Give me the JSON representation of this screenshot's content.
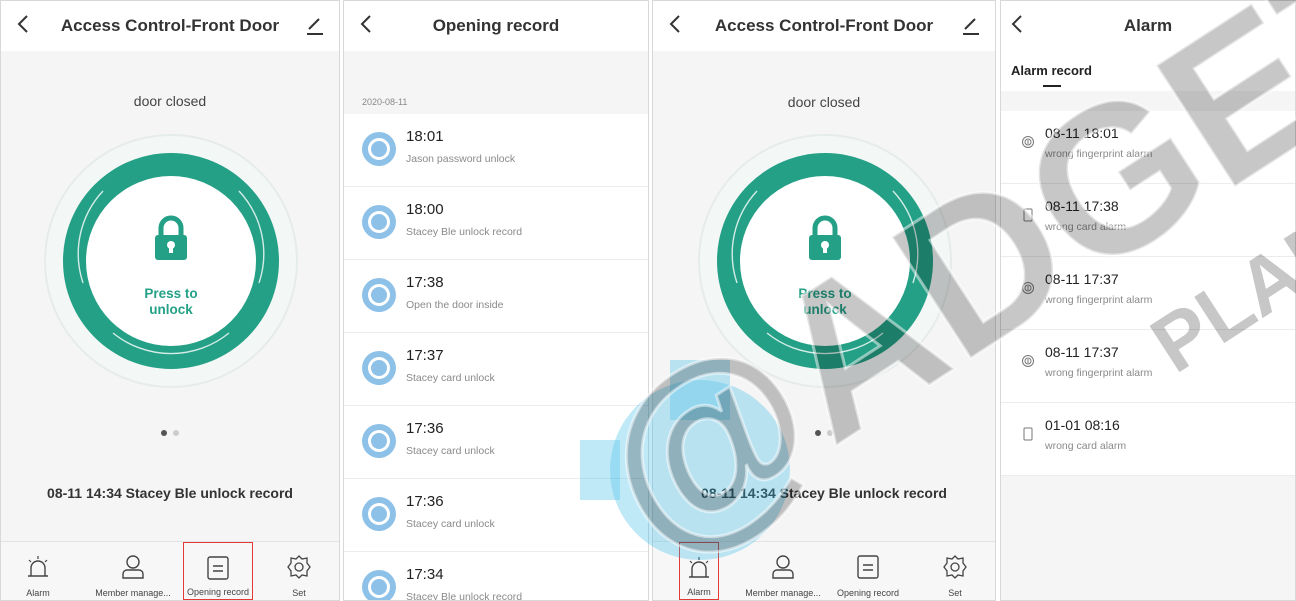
{
  "colors": {
    "accent": "#24a086",
    "ring_light": "#e7eeec",
    "avatar": "#8ec1e8",
    "highlight": "#e53935"
  },
  "control_left": {
    "title": "Access Control-Front Door",
    "door_status": "door closed",
    "press_line1": "Press to",
    "press_line2": "unlock",
    "last_record": "08-11 14:34 Stacey Ble unlock record",
    "tabs": [
      {
        "label": "Alarm",
        "icon": "alarm-siren-icon"
      },
      {
        "label": "Member manage...",
        "icon": "person-icon"
      },
      {
        "label": "Opening record",
        "icon": "record-list-icon"
      },
      {
        "label": "Set",
        "icon": "gear-icon"
      }
    ]
  },
  "opening_record": {
    "title": "Opening record",
    "date": "2020-08-11",
    "records": [
      {
        "time": "18:01",
        "desc": "Jason password unlock"
      },
      {
        "time": "18:00",
        "desc": "Stacey Ble unlock record"
      },
      {
        "time": "17:38",
        "desc": " Open the door inside"
      },
      {
        "time": "17:37",
        "desc": "Stacey card unlock"
      },
      {
        "time": "17:36",
        "desc": "Stacey card unlock"
      },
      {
        "time": "17:36",
        "desc": "Stacey card unlock"
      },
      {
        "time": "17:34",
        "desc": "Stacey Ble unlock record"
      }
    ]
  },
  "control_right": {
    "title": "Access Control-Front Door",
    "door_status": "door closed",
    "press_line1": "Press to",
    "press_line2": "unlock",
    "last_record": "08-11 14:34 Stacey Ble unlock record",
    "tabs": [
      {
        "label": "Alarm",
        "icon": "alarm-siren-icon"
      },
      {
        "label": "Member manage...",
        "icon": "person-icon"
      },
      {
        "label": "Opening record",
        "icon": "record-list-icon"
      },
      {
        "label": "Set",
        "icon": "gear-icon"
      }
    ]
  },
  "alarm": {
    "title": "Alarm",
    "subtab": "Alarm record",
    "records": [
      {
        "time": "08-11 18:01",
        "desc": "wrong fingerprint alarm",
        "icon": "fingerprint-icon"
      },
      {
        "time": "08-11 17:38",
        "desc": "wrong card alarm",
        "icon": "card-icon"
      },
      {
        "time": "08-11 17:37",
        "desc": "wrong fingerprint alarm",
        "icon": "fingerprint-icon"
      },
      {
        "time": "08-11 17:37",
        "desc": "wrong fingerprint alarm",
        "icon": "fingerprint-icon"
      },
      {
        "time": "01-01 08:16",
        "desc": "wrong card alarm",
        "icon": "card-icon"
      }
    ]
  },
  "watermark": {
    "main": "@ADGET",
    "sub": "PLAN"
  }
}
